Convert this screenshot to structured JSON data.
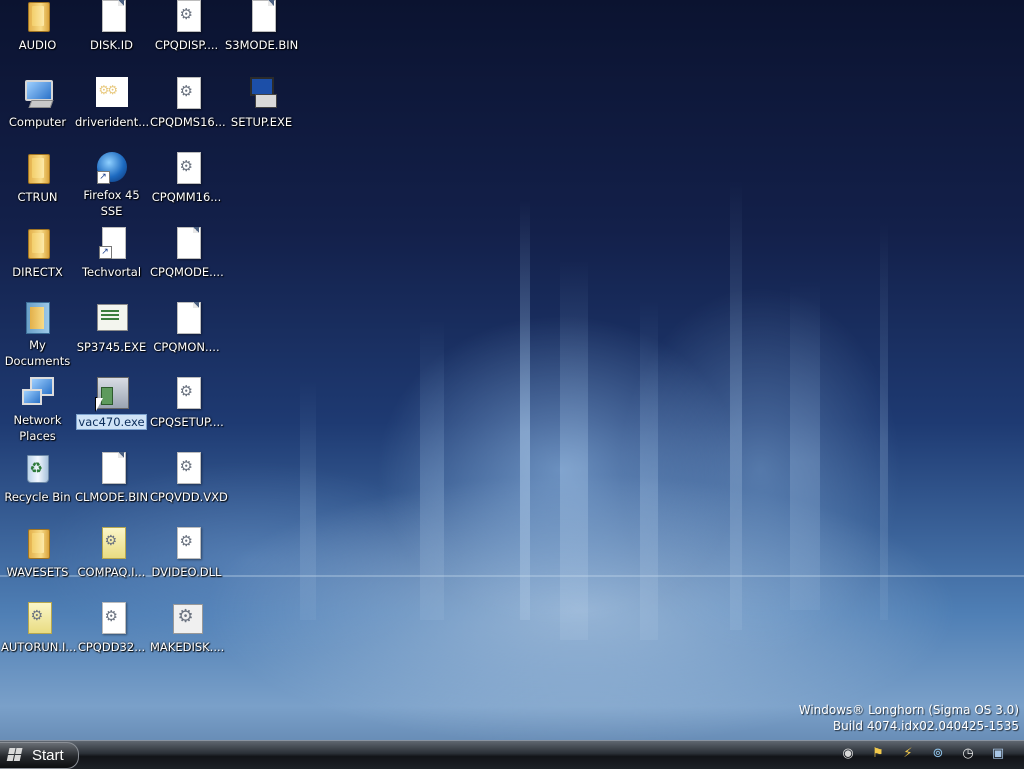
{
  "desktop": {
    "icons": [
      {
        "label": "AUDIO",
        "icon": "folder-icon"
      },
      {
        "label": "Computer",
        "icon": "computer-icon"
      },
      {
        "label": "CTRUN",
        "icon": "folder-icon"
      },
      {
        "label": "DIRECTX",
        "icon": "folder-icon"
      },
      {
        "label": "My Documents",
        "icon": "my-documents-icon"
      },
      {
        "label": "Network Places",
        "icon": "network-places-icon"
      },
      {
        "label": "Recycle Bin",
        "icon": "recycle-bin-icon"
      },
      {
        "label": "WAVESETS",
        "icon": "folder-icon"
      },
      {
        "label": "AUTORUN.I...",
        "icon": "config-file-icon"
      },
      {
        "label": "DISK.ID",
        "icon": "document-icon"
      },
      {
        "label": "driverident...",
        "icon": "driver-icon"
      },
      {
        "label": "Firefox 45 SSE",
        "icon": "firefox-shortcut-icon"
      },
      {
        "label": "Techvortal",
        "icon": "shortcut-document-icon"
      },
      {
        "label": "SP3745.EXE",
        "icon": "installer-icon"
      },
      {
        "label": "vac470.exe",
        "icon": "application-icon",
        "selected": true
      },
      {
        "label": "CLMODE.BIN",
        "icon": "document-icon"
      },
      {
        "label": "COMPAQ.I...",
        "icon": "config-file-icon"
      },
      {
        "label": "CPQDD32...",
        "icon": "system-file-icon"
      },
      {
        "label": "CPQDISP....",
        "icon": "system-file-icon"
      },
      {
        "label": "CPQDMS16...",
        "icon": "system-file-icon"
      },
      {
        "label": "CPQMM16...",
        "icon": "system-file-icon"
      },
      {
        "label": "CPQMODE....",
        "icon": "document-icon"
      },
      {
        "label": "CPQMON....",
        "icon": "document-icon"
      },
      {
        "label": "CPQSETUP....",
        "icon": "system-file-icon"
      },
      {
        "label": "CPQVDD.VXD",
        "icon": "system-file-icon"
      },
      {
        "label": "DVIDEO.DLL",
        "icon": "system-file-icon"
      },
      {
        "label": "MAKEDISK....",
        "icon": "batch-file-icon"
      },
      {
        "label": "S3MODE.BIN",
        "icon": "document-icon"
      },
      {
        "label": "SETUP.EXE",
        "icon": "setup-icon"
      }
    ]
  },
  "watermark": {
    "line1": "Windows® Longhorn (Sigma OS 3.0)",
    "line2": "Build 4074.idx02.040425-1535"
  },
  "taskbar": {
    "start_label": "Start",
    "tray_icons": [
      "media-icon",
      "flag-icon",
      "power-icon",
      "network-icon",
      "clock-icon",
      "window-icon"
    ]
  },
  "colors": {
    "taskbar": "#1d2127",
    "selection": "#cfe3f7",
    "accent_blue": "#1e3a72"
  }
}
